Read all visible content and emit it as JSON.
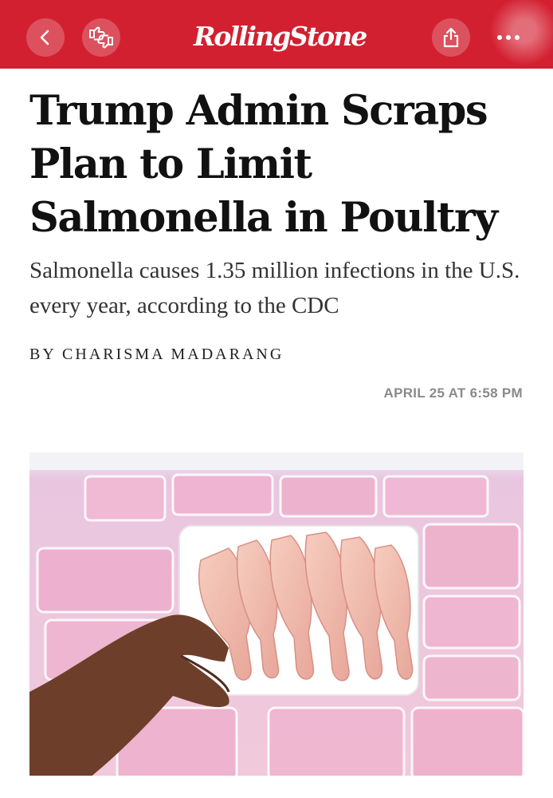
{
  "header": {
    "brand": "RollingStone",
    "back_icon": "chevron-left-icon",
    "react_icon": "thumbs-up-down-icon",
    "share_icon": "share-icon",
    "more_icon": "more-horizontal-icon",
    "color": "#d32031"
  },
  "article": {
    "headline": "Trump Admin Scraps Plan to Limit Salmonella in Poultry",
    "dek": "Salmonella causes 1.35 million infections in the U.S. every year, according to the CDC",
    "byline": "BY CHARISMA MADARANG",
    "date": "APRIL 25 AT 6:58 PM",
    "image_subject": "hand holding package of raw chicken drumsticks"
  }
}
